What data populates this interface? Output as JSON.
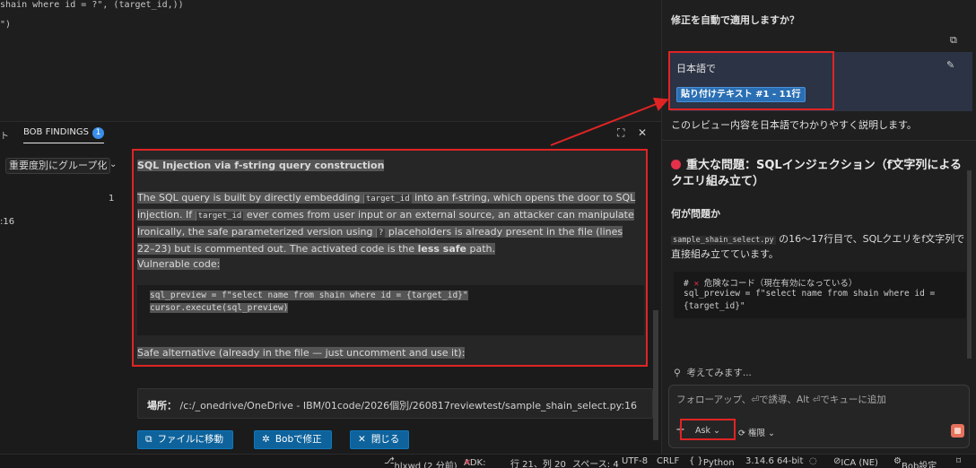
{
  "editor": {
    "line1": "shain where id = ?\", (target_id,))",
    "line2": "\")"
  },
  "panel": {
    "prev_tab_label": "ト",
    "findings_tab_label": "BOB FINDINGS",
    "findings_count": "1",
    "group_select": "重要度別にグループ化",
    "group_count": "1",
    "line_ref": ":16"
  },
  "detail": {
    "title": "SQL Injection via f-string query construction",
    "para1_a": "The SQL query is built by directly embedding ",
    "para1_code1": "target_id",
    "para1_b": " into an f-string, which opens the door to SQL injection. If ",
    "para1_code2": "target_id",
    "para1_c": " ever comes from user input or an external source, an attacker can manipulate the query arbitrarily.",
    "para2_a": "Ironically, the safe parameterized version using ",
    "para2_code": "?",
    "para2_b": " placeholders is already present in the file (lines 22–23) but is commented out. The activated code is the ",
    "para2_bold": "less safe",
    "para2_c": " path.",
    "vuln_label": "Vulnerable code:",
    "code_line1": "sql_preview = f\"select name from shain where id = {target_id}\"",
    "code_line2": "cursor.execute(sql_preview)",
    "safe_label": "Safe alternative (already in the file — just uncomment and use it):"
  },
  "location": {
    "label": "場所：",
    "path": "/c:/_onedrive/OneDrive - IBM/01code/2026個別/260817reviewtest/sample_shain_select.py:16"
  },
  "buttons": {
    "goto_file": "ファイルに移動",
    "fix_with_bob": "Bobで修正",
    "close": "閉じる"
  },
  "chat": {
    "question": "修正を自動で適用しますか？",
    "user_lang": "日本語で",
    "paste_chip": "貼り付けテキスト #1 - 11行",
    "request_desc": "このレビュー内容を日本語でわかりやすく説明します。",
    "issue_heading": "重大な問題：SQLインジェクション（f文字列によるクエリ組み立て）",
    "what_heading": "何が問題か",
    "desc_file": "sample_shain_select.py",
    "desc_text": " の16〜17行目で、SQLクエリをf文字列で直接組み立てています。",
    "code_comment": " 危険なコード（現在有効になっている）",
    "code_line1": "sql_preview = f\"select name from shain where id =",
    "code_line2": "{target_id}\"",
    "thinking": "考えてみます...",
    "input_placeholder": "フォローアップ、⏎で誘導、Alt ⏎でキューに追加",
    "ask_label": "Ask",
    "perm_label": "権限"
  },
  "status": {
    "branch": "hlxwd (2 分前)",
    "adk_label": "ADK:",
    "cursor": "行 21、列 20",
    "spaces": "スペース: 4",
    "encoding": "UTF-8",
    "eol": "CRLF",
    "language": "Python",
    "version": "3.14.6 64-bit",
    "ica": "ICA (NE)",
    "bob_settings": "Bob設定"
  },
  "colors": {
    "accent_blue": "#0e639c",
    "highlight_red": "#e02424",
    "danger_dot": "#e5304a"
  }
}
